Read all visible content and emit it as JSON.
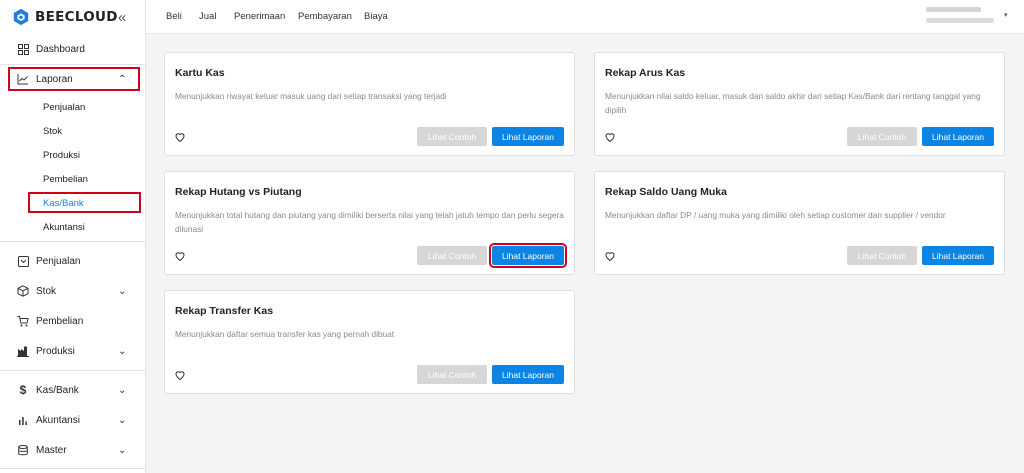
{
  "brand": {
    "name": "BEECLOUD"
  },
  "sidebar": {
    "dashboard": "Dashboard",
    "laporan": "Laporan",
    "laporan_sub": [
      "Penjualan",
      "Stok",
      "Produksi",
      "Pembelian",
      "Kas/Bank",
      "Akuntansi"
    ],
    "penjualan": "Penjualan",
    "stok": "Stok",
    "pembelian": "Pembelian",
    "produksi": "Produksi",
    "kasbank": "Kas/Bank",
    "akuntansi": "Akuntansi",
    "master": "Master"
  },
  "topnav": [
    "Beli",
    "Jual",
    "Penerimaan",
    "Pembayaran",
    "Biaya"
  ],
  "buttons": {
    "contoh": "Lihat Contoh",
    "laporan": "Lihat Laporan"
  },
  "cards": [
    {
      "title": "Kartu Kas",
      "desc": "Menunjukkan riwayat keluar masuk uang dari setiap transaksi yang terjadi"
    },
    {
      "title": "Rekap Arus Kas",
      "desc": "Menunjukkan nilai saldo keluar, masuk dan saldo akhir dari setiap Kas/Bank dari rentang tanggal yang dipilih"
    },
    {
      "title": "Rekap Hutang vs Piutang",
      "desc": "Menunjukkan total hutang dan piutang yang dimiliki berserta nilai yang telah jatuh tempo dan perlu segera dilunasi"
    },
    {
      "title": "Rekap Saldo Uang Muka",
      "desc": "Menunjukkan daftar DP / uang muka yang dimiliki oleh setiap customer dan supplier / vendor"
    },
    {
      "title": "Rekap Transfer Kas",
      "desc": "Menunjukkan daftar semua transfer kas yang pernah dibuat"
    }
  ],
  "colors": {
    "accent": "#0b84e4",
    "highlight": "#d0021b",
    "brand": "#1e7ee0"
  }
}
